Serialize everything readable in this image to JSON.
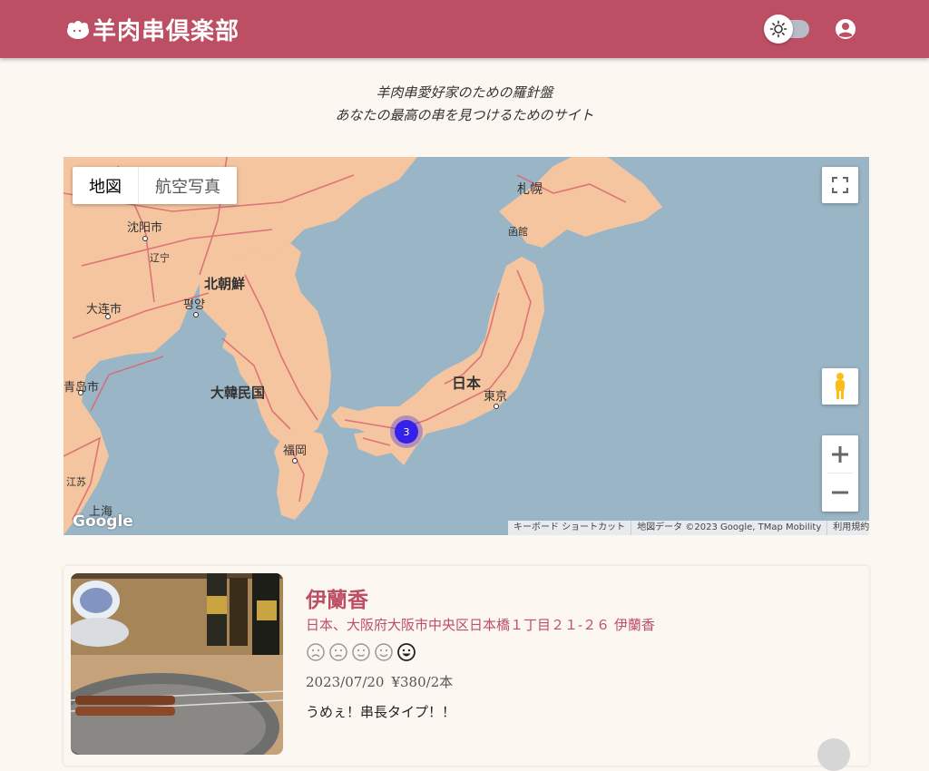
{
  "header": {
    "title": "羊肉串倶楽部",
    "logo_icon": "lamb-icon",
    "theme_toggle_icon": "sun-icon",
    "account_icon": "account-circle-icon",
    "bg_color": "#bd4f64"
  },
  "tagline": {
    "line1": "羊肉串愛好家のための羅針盤",
    "line2": "あなたの最高の串を見つけるためのサイト"
  },
  "map": {
    "type_controls": [
      "地図",
      "航空写真"
    ],
    "selected_type": "地図",
    "labels": {
      "sapporo": "札幌",
      "hakodate": "函館",
      "north_korea": "北朝鮮",
      "pyongyang": "평양",
      "south_korea": "大韓民国",
      "japan": "日本",
      "tokyo": "東京",
      "fukuoka": "福岡",
      "shenyang": "沈阳市",
      "liaoning": "辽宁",
      "dalian": "大连市",
      "qingdao": "青岛市",
      "jiangsu": "江苏",
      "shanghai": "上海"
    },
    "cluster_count": "3",
    "attribution": [
      "キーボード ショートカット",
      "地図データ ©2023 Google, TMap Mobility",
      "利用規約"
    ],
    "google_logo": "Google",
    "controls": [
      "fullscreen-icon",
      "pegman-icon",
      "zoom-in-icon",
      "zoom-out-icon"
    ]
  },
  "post": {
    "shop_name": "伊蘭香",
    "address": "日本、大阪府大阪市中央区日本橋１丁目２１-２６ 伊蘭香",
    "rating": 5,
    "rating_max": 5,
    "date": "2023/07/20",
    "price": "¥380/2本",
    "comment": "うめぇ！串長タイプ！！"
  }
}
